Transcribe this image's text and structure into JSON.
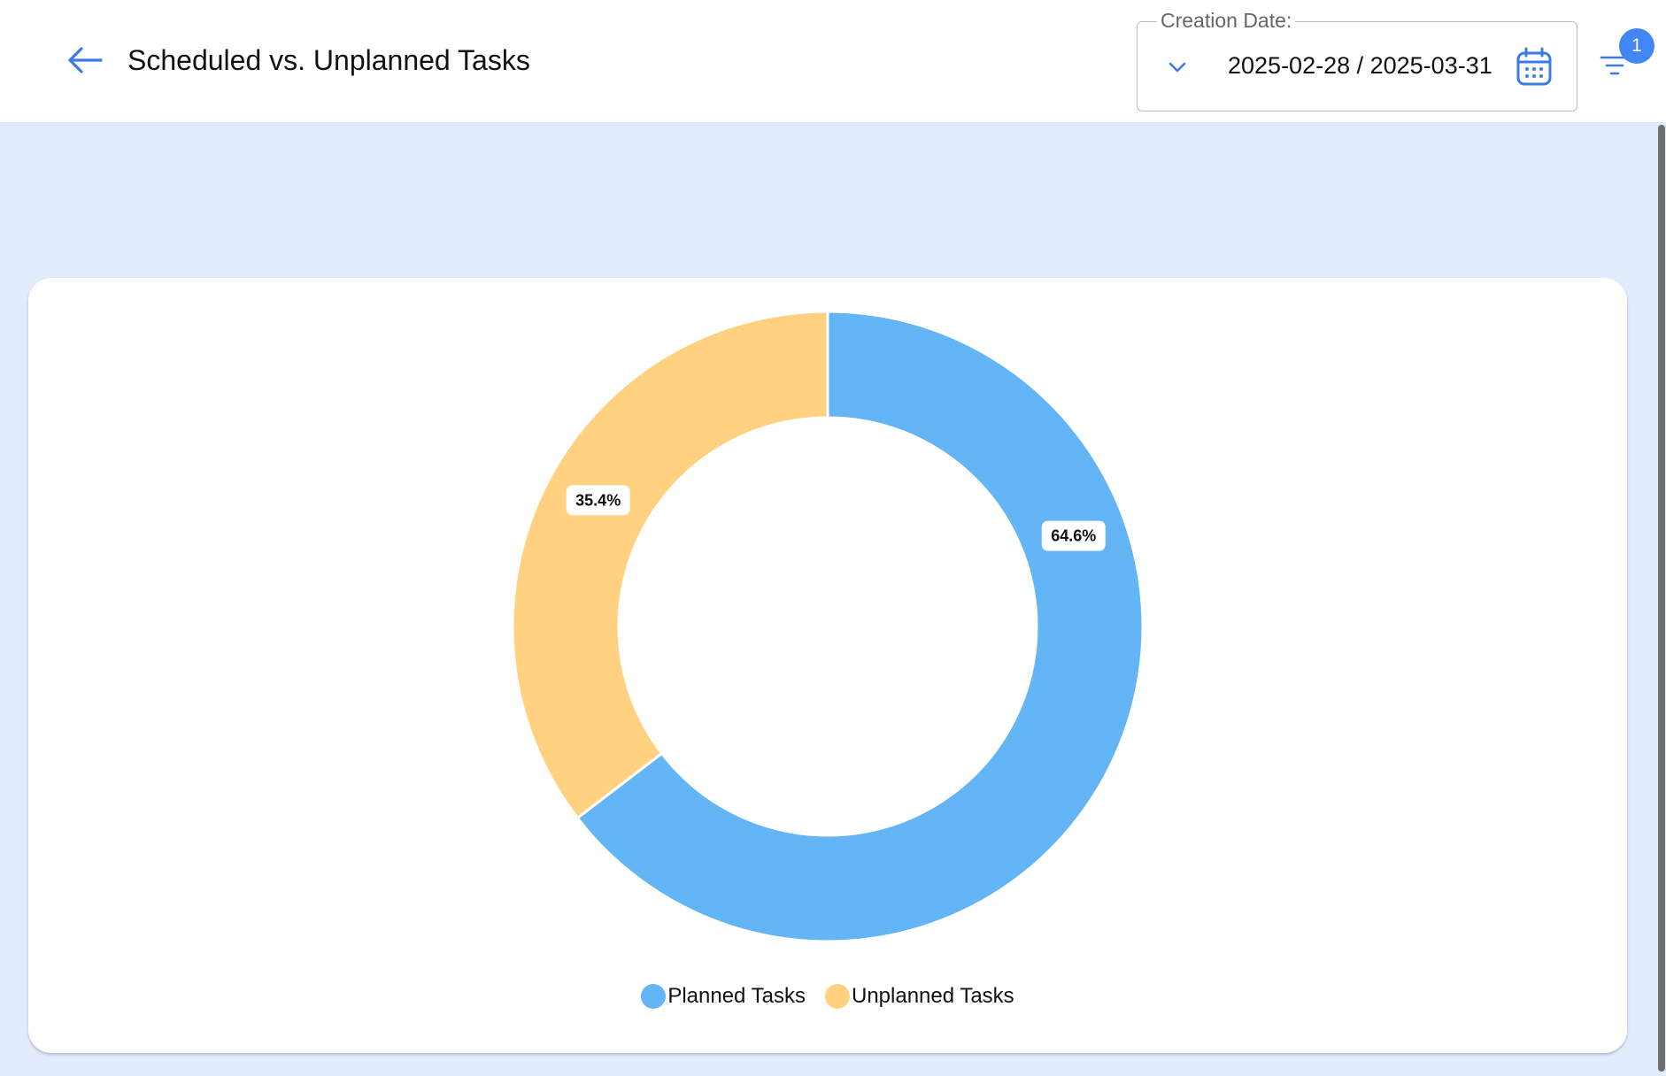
{
  "header": {
    "title": "Scheduled vs. Unplanned Tasks",
    "back_icon": "arrow-left-icon",
    "date_filter": {
      "label": "Creation Date:",
      "value": "2025-02-28 / 2025-03-31",
      "chevron_icon": "chevron-down-icon",
      "calendar_icon": "calendar-icon"
    },
    "filter": {
      "icon": "filter-icon",
      "badge_count": "1"
    }
  },
  "colors": {
    "accent": "#4285f4",
    "content_background": "#e3ecfc",
    "planned": "#64b5f6",
    "unplanned": "#ffd180"
  },
  "chart_data": {
    "type": "pie",
    "donut": true,
    "categories": [
      "Planned Tasks",
      "Unplanned Tasks"
    ],
    "values": [
      64.6,
      35.4
    ],
    "labels": [
      "64.6%",
      "35.4%"
    ],
    "colors": [
      "#64b5f6",
      "#ffd180"
    ],
    "legend_position": "bottom-center"
  }
}
